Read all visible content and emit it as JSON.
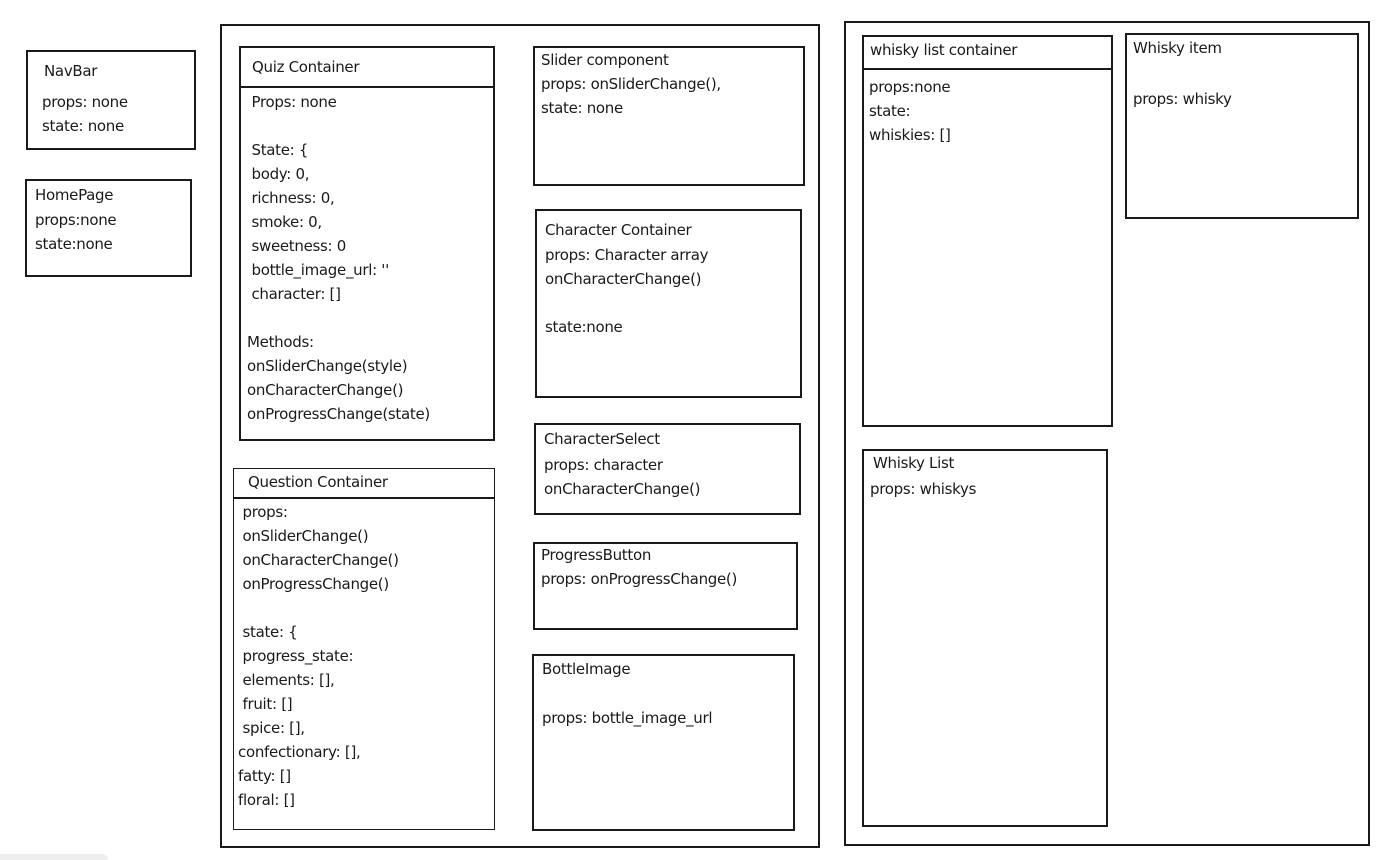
{
  "navbar": {
    "title": "NavBar",
    "lines": [
      "props: none",
      "state: none"
    ]
  },
  "homepage": {
    "title": "HomePage",
    "lines": [
      "props:none",
      "state:none"
    ]
  },
  "quiz": {
    "title": "Quiz Container",
    "lines": [
      " Props: none",
      "",
      " State: {",
      " body: 0,",
      " richness: 0,",
      " smoke: 0,",
      " sweetness: 0",
      " bottle_image_url: ''",
      " character: []",
      "",
      "Methods:",
      "onSliderChange(style)",
      "onCharacterChange()",
      "onProgressChange(state)"
    ]
  },
  "question": {
    "title": "Question Container",
    "lines": [
      " props:",
      " onSliderChange()",
      " onCharacterChange()",
      " onProgressChange()",
      "",
      " state: {",
      " progress_state:",
      " elements: [],",
      " fruit: []",
      " spice: [],",
      "confectionary: [],",
      "fatty: []",
      "floral: []"
    ]
  },
  "slider": {
    "title": "Slider component",
    "lines": [
      "props: onSliderChange(),",
      "state: none"
    ]
  },
  "character_container": {
    "title": "Character Container",
    "lines": [
      "props: Character array",
      "onCharacterChange()",
      "",
      "state:none"
    ]
  },
  "character_select": {
    "title": "CharacterSelect",
    "lines": [
      "props: character",
      "onCharacterChange()"
    ]
  },
  "progress_button": {
    "title": "ProgressButton",
    "lines": [
      "props: onProgressChange()"
    ]
  },
  "bottle_image": {
    "title": "BottleImage",
    "lines": [
      "",
      "props: bottle_image_url"
    ]
  },
  "whisky_list_container": {
    "title": "whisky list container",
    "lines": [
      "props:none",
      "state:",
      "whiskies: []"
    ]
  },
  "whisky_item": {
    "title": "Whisky item",
    "lines": [
      "",
      "props: whisky"
    ]
  },
  "whisky_list": {
    "title": "Whisky List",
    "lines": [
      "props: whiskys"
    ]
  }
}
